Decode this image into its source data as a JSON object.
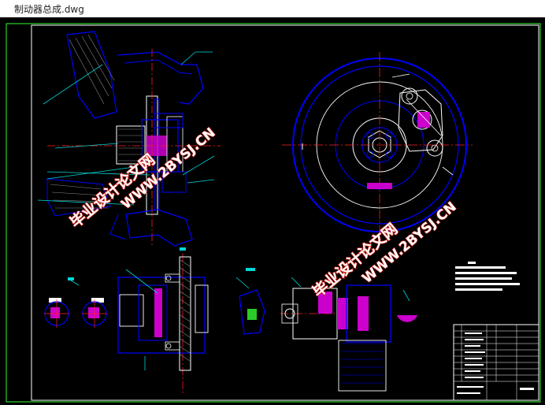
{
  "window": {
    "title": "制动器总成.dwg"
  },
  "watermarks": {
    "chinese": "毕业设计论文网",
    "url": "WWW.2BYSJ.CN"
  },
  "colors": {
    "background": "#000000",
    "line": "#0000ff",
    "highlight": "#cc00cc",
    "leader": "#00d8d8",
    "center": "#ff2020",
    "border": "#33ff33",
    "hatch": "#e0e0e0"
  }
}
